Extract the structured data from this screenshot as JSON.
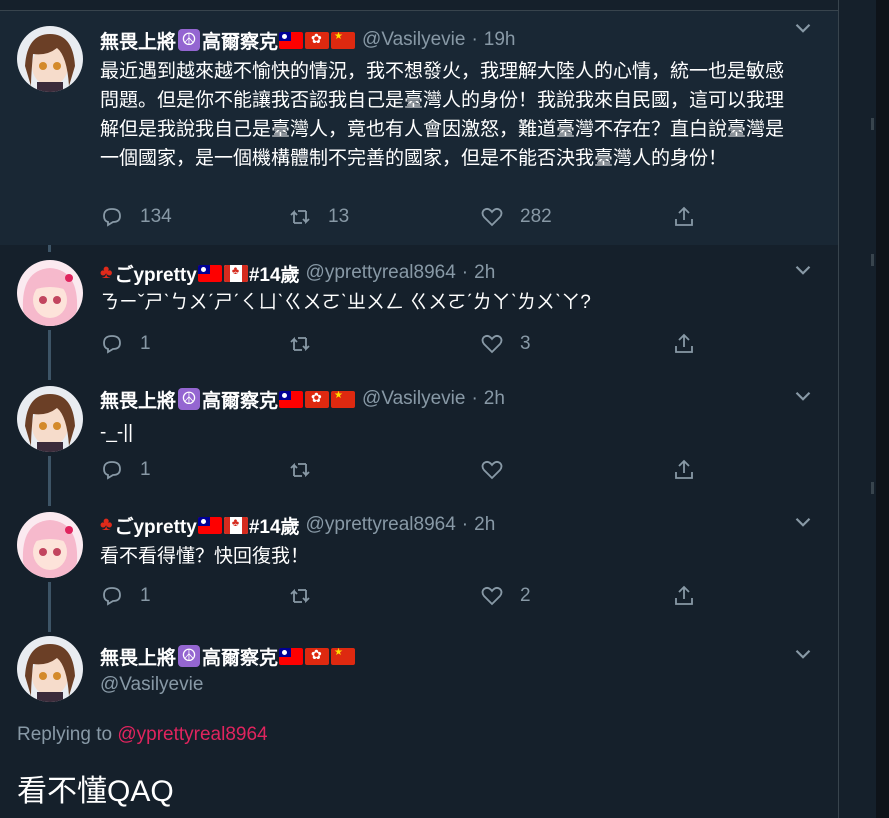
{
  "tweets": [
    {
      "display_name_a": "無畏上將",
      "display_name_b": "高爾察克",
      "handle": "@Vasilyevie",
      "time": "19h",
      "text": "最近遇到越來越不愉快的情況，我不想發火，我理解大陸人的心情，統一也是敏感問題。但是你不能讓我否認我自己是臺灣人的身份！我說我來自民國，這可以我理解但是我說我自己是臺灣人，竟也有人會因激怒，難道臺灣不存在？直白說臺灣是一個國家，是一個機構體制不完善的國家，但是不能否決我臺灣人的身份！",
      "replies": "134",
      "retweets": "13",
      "likes": "282"
    },
    {
      "display_name_a": "ごypretty",
      "display_name_b": "#14歲",
      "handle": "@yprettyreal8964",
      "time": "2h",
      "text": "ㄋㄧˇㄕˋㄅㄨˊㄕˊㄑㄩˋㄍㄨㄛˋㄓㄨㄥ ㄍㄨㄛˊㄌㄚˋㄌㄨˋㄚ?",
      "replies": "1",
      "retweets": "",
      "likes": "3"
    },
    {
      "display_name_a": "無畏上將",
      "display_name_b": "高爾察克",
      "handle": "@Vasilyevie",
      "time": "2h",
      "text": "-_-||",
      "replies": "1",
      "retweets": "",
      "likes": ""
    },
    {
      "display_name_a": "ごypretty",
      "display_name_b": "#14歲",
      "handle": "@yprettyreal8964",
      "time": "2h",
      "text": "看不看得懂？快回復我！",
      "replies": "1",
      "retweets": "",
      "likes": "2"
    }
  ],
  "main": {
    "display_name_a": "無畏上將",
    "display_name_b": "高爾察克",
    "handle": "@Vasilyevie",
    "replying_prefix": "Replying to",
    "replying_handle": "@yprettyreal8964",
    "text": "看不懂QAQ"
  },
  "separator": "·",
  "icons": {
    "reply": "reply-icon",
    "retweet": "retweet-icon",
    "like": "heart-icon",
    "share": "share-icon",
    "caret": "chevron-down-icon",
    "peace": "peace-symbol-icon",
    "maple": "maple-leaf-icon"
  },
  "colors": {
    "background": "#15202b",
    "highlight": "#192734",
    "muted": "#8899a6",
    "mention": "#e0245e",
    "thread": "#3d5466"
  }
}
